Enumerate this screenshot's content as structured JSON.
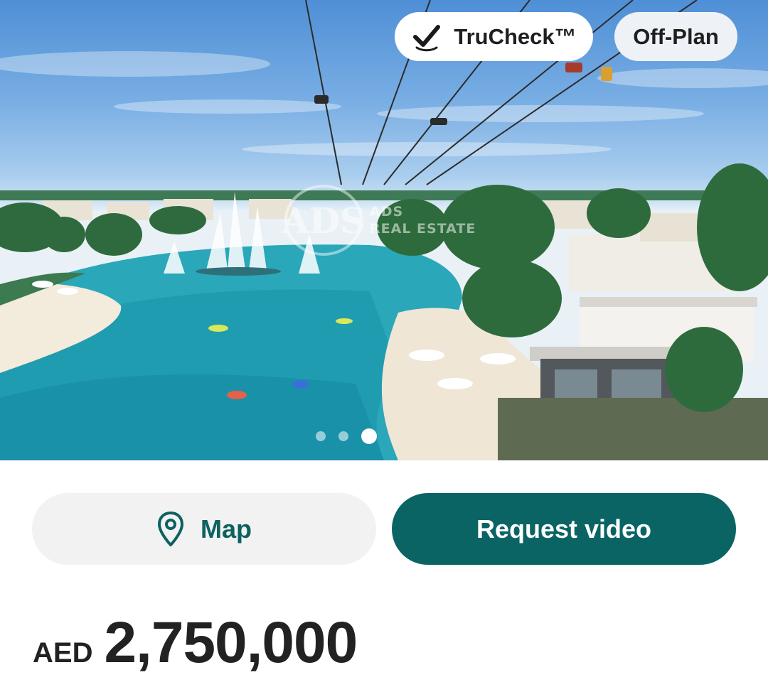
{
  "listing": {
    "badges": {
      "trucheck": "TruCheck™",
      "offplan": "Off-Plan"
    },
    "watermark": {
      "logo": "ADS",
      "line1": "ADS",
      "line2": "REAL ESTATE"
    },
    "carousel": {
      "total_images": 3,
      "active_index": 3
    },
    "actions": {
      "map_label": "Map",
      "video_label": "Request video"
    },
    "price": {
      "currency": "AED",
      "amount": "2,750,000"
    },
    "icons": {
      "trucheck": "check-icon",
      "map": "location-pin-icon"
    },
    "colors": {
      "primary": "#0b6464",
      "map_text": "#0d6161",
      "map_button_bg": "#f2f2f2",
      "badge_bg": "#ffffff"
    }
  }
}
